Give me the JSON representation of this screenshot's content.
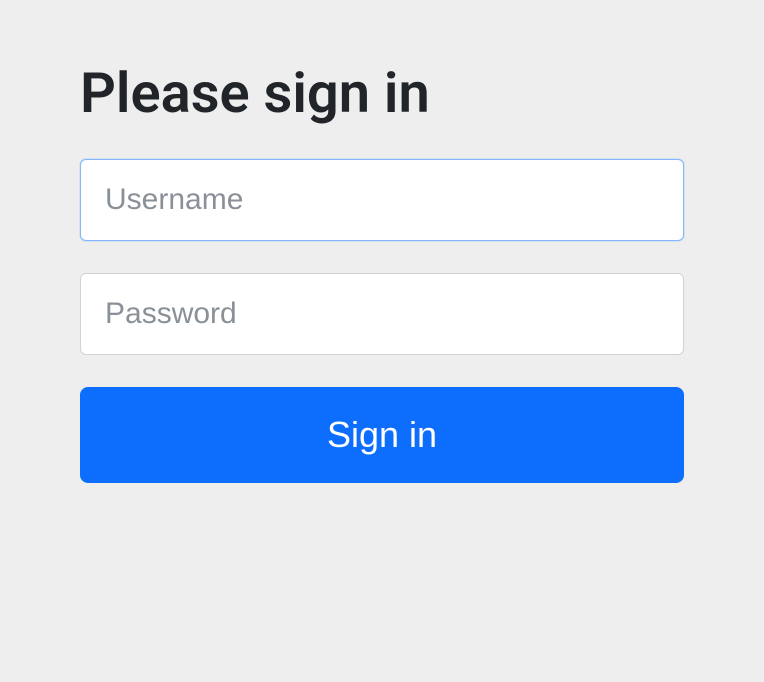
{
  "heading": "Please sign in",
  "form": {
    "username": {
      "placeholder": "Username",
      "value": ""
    },
    "password": {
      "placeholder": "Password",
      "value": ""
    },
    "submit_label": "Sign in"
  }
}
